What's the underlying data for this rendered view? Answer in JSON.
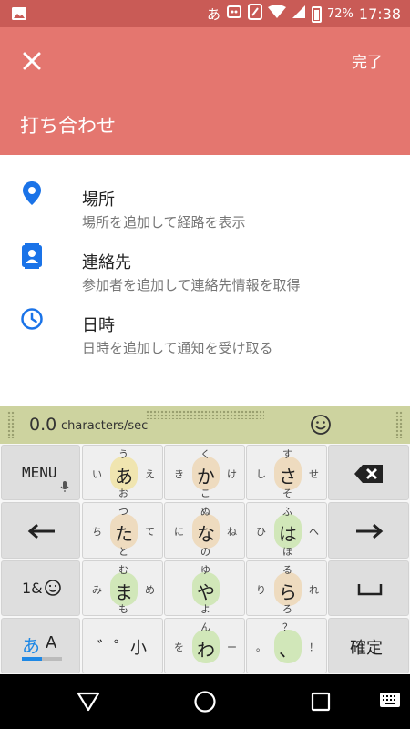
{
  "status_bar": {
    "ime_char": "あ",
    "battery_pct": "72%",
    "time": "17:38",
    "battery_level": 0.72
  },
  "header": {
    "close_icon": "close-icon",
    "done_label": "完了",
    "title": "打ち合わせ",
    "bg_color": "#e4766f"
  },
  "list": [
    {
      "icon": "location-pin-icon",
      "title": "場所",
      "subtitle": "場所を追加して経路を表示"
    },
    {
      "icon": "contact-card-icon",
      "title": "連絡先",
      "subtitle": "参加者を追加して連絡先情報を取得"
    },
    {
      "icon": "clock-icon",
      "title": "日時",
      "subtitle": "日時を追加して通知を受け取る"
    }
  ],
  "keyboard_topbar": {
    "speed_value": "0.0",
    "speed_unit": "characters/sec",
    "emoji_icon": "smiley-icon"
  },
  "keyboard": {
    "left_keys": {
      "menu_label": "MENU",
      "symbols_label": "1&",
      "mode_label_a": "あ",
      "mode_label_b": "A"
    },
    "right_keys": {
      "backspace_icon": "backspace-icon",
      "right_arrow_icon": "right-arrow-icon",
      "space_icon": "space-icon",
      "enter_label": "確定"
    },
    "kana_keys": [
      {
        "main": "あ",
        "up": "う",
        "left": "い",
        "right": "え",
        "down": "お"
      },
      {
        "main": "か",
        "up": "く",
        "left": "き",
        "right": "け",
        "down": "こ"
      },
      {
        "main": "さ",
        "up": "す",
        "left": "し",
        "right": "せ",
        "down": "そ"
      },
      {
        "main": "た",
        "up": "つ",
        "left": "ち",
        "right": "て",
        "down": "と"
      },
      {
        "main": "な",
        "up": "ぬ",
        "left": "に",
        "right": "ね",
        "down": "の"
      },
      {
        "main": "は",
        "up": "ふ",
        "left": "ひ",
        "right": "へ",
        "down": "ほ"
      },
      {
        "main": "ま",
        "up": "む",
        "left": "み",
        "right": "め",
        "down": "も"
      },
      {
        "main": "や",
        "up": "ゆ",
        "left": "",
        "right": "",
        "down": "よ"
      },
      {
        "main": "ら",
        "up": "る",
        "left": "り",
        "right": "れ",
        "down": "ろ"
      },
      {
        "main": "",
        "up": "",
        "left": "",
        "right": "",
        "down": "",
        "special": "゛゜小"
      },
      {
        "main": "わ",
        "up": "ん",
        "left": "を",
        "right": "ー",
        "down": ""
      },
      {
        "main": "、",
        "up": "？",
        "left": "。",
        "right": "！",
        "down": ""
      }
    ]
  },
  "nav_bar": {
    "back_icon": "back-triangle-icon",
    "home_icon": "home-circle-icon",
    "recents_icon": "recents-square-icon",
    "keyboard_icon": "keyboard-icon"
  }
}
